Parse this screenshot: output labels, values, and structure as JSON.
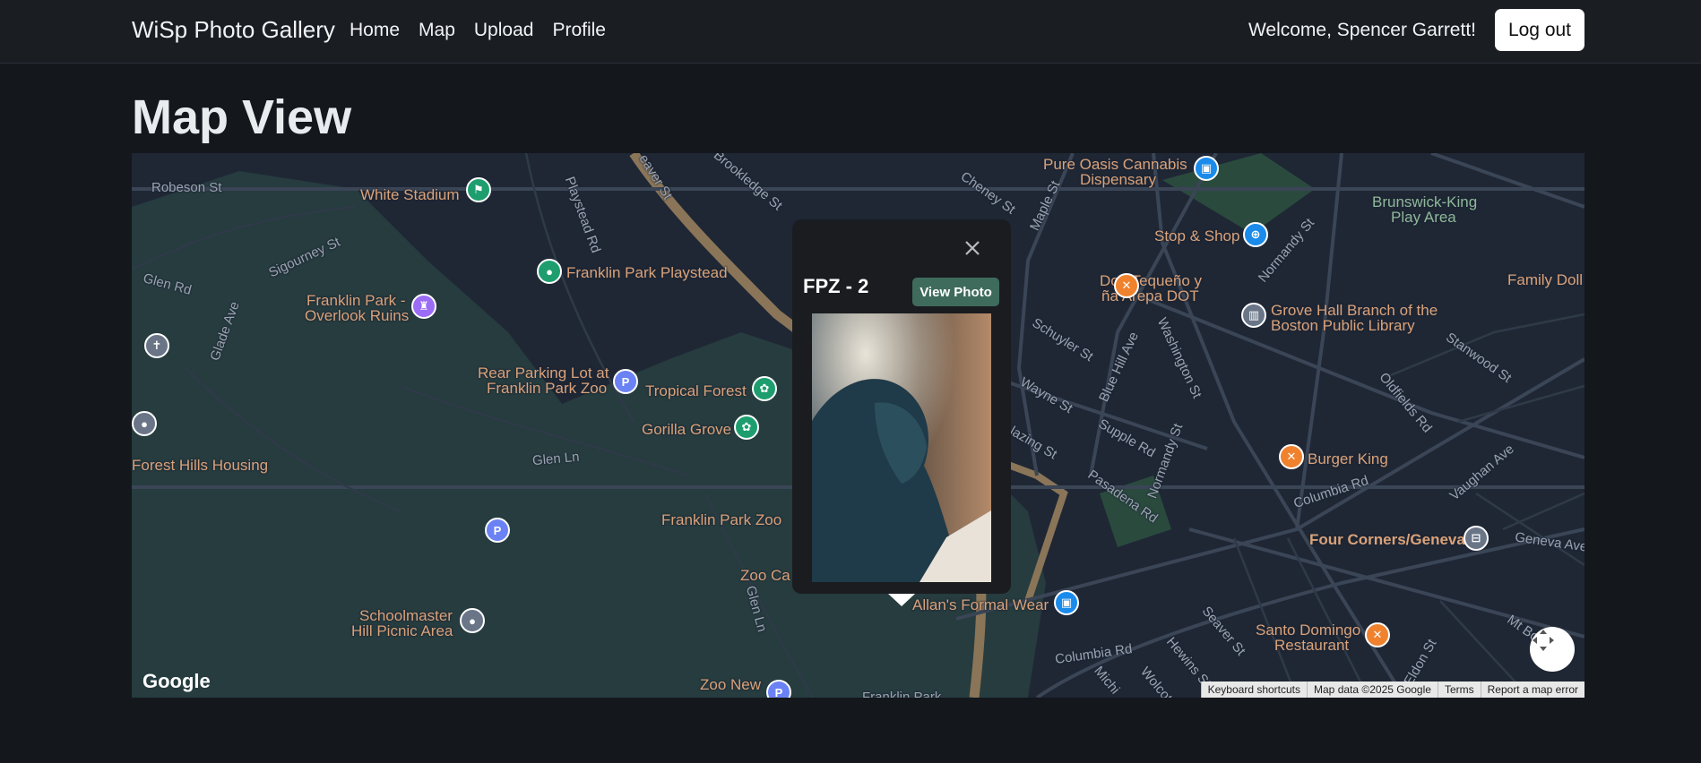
{
  "navbar": {
    "brand": "WiSp Photo Gallery",
    "links": [
      "Home",
      "Map",
      "Upload",
      "Profile"
    ],
    "welcome": "Welcome, Spencer Garrett!",
    "logout_label": "Log out"
  },
  "page": {
    "title": "Map View"
  },
  "map": {
    "labels": {
      "robeson": "Robeson St",
      "white_stadium": "White Stadium",
      "playstead_rd": "Playstead Rd",
      "seaver_st": "eaver St",
      "brookledge": "Brookledge St",
      "cheney": "Cheney St",
      "maple": "Maple St",
      "pure_oasis": "Pure Oasis Cannabis",
      "pure_oasis2": "Dispensary",
      "brunswick": "Brunswick-King",
      "brunswick2": "Play Area",
      "stop_shop": "Stop & Shop",
      "normandy": "Normandy St",
      "family_doll": "Family Doll",
      "sigourney": "Sigourney St",
      "glen_rd": "Glen Rd",
      "franklin_playstead": "Franklin Park Playstead",
      "franklin_overlook": "Franklin Park -",
      "franklin_overlook2": "Overlook Ruins",
      "glade": "Glade Ave",
      "don_tequeno": "Don Tequeño y",
      "don_tequeno2": "ña Arepa DOT",
      "grove_hall": "Grove Hall Branch of the",
      "grove_hall2": "Boston Public Library",
      "schuyler": "Schuyler St",
      "washington": "Washington St",
      "blue_hill": "Blue Hill Ave",
      "stanwood": "Stanwood St",
      "oldfields": "Oldfields Rd",
      "rear_lot": "Rear Parking Lot at",
      "rear_lot2": "Franklin Park Zoo",
      "tropical": "Tropical Forest",
      "gorilla": "Gorilla Grove",
      "wayne": "Wayne St",
      "glen_ln": "Glen Ln",
      "forest_hills": "Forest Hills Housing",
      "hazing": "lazing St",
      "supple": "Supple Rd",
      "normandy2": "Normandy St",
      "burger_king": "Burger King",
      "vaughan": "Vaughan Ave",
      "columbia_rd": "Columbia Rd",
      "pasadena": "Pasadena Rd",
      "franklin_zoo": "Franklin Park Zoo",
      "four_corners": "Four Corners/Geneva",
      "geneva": "Geneva Ave",
      "zoo_ca": "Zoo Ca",
      "glen_ln2": "Glen Ln",
      "allans": "Allan's Formal Wear",
      "schoolmaster": "Schoolmaster",
      "schoolmaster2": "Hill Picnic Area",
      "seaver2": "Seaver St",
      "santo_domingo": "Santo Domingo",
      "santo_domingo2": "Restaurant",
      "mt_bowdoin": "Mt Bowdo",
      "columbia2": "Columbia Rd",
      "hewins": "Hewins St",
      "michigan": "Michi",
      "wolcott": "Wolcot",
      "eldon": "Eldon St",
      "zoo_new": "Zoo New",
      "franklin_park_bottom": "Franklin Park"
    },
    "google_logo": "Google",
    "attribution": [
      "Keyboard shortcuts",
      "Map data ©2025 Google",
      "Terms",
      "Report a map error"
    ],
    "pin_parking": "P"
  },
  "popup": {
    "title": "FPZ - 2",
    "view_label": "View Photo"
  }
}
